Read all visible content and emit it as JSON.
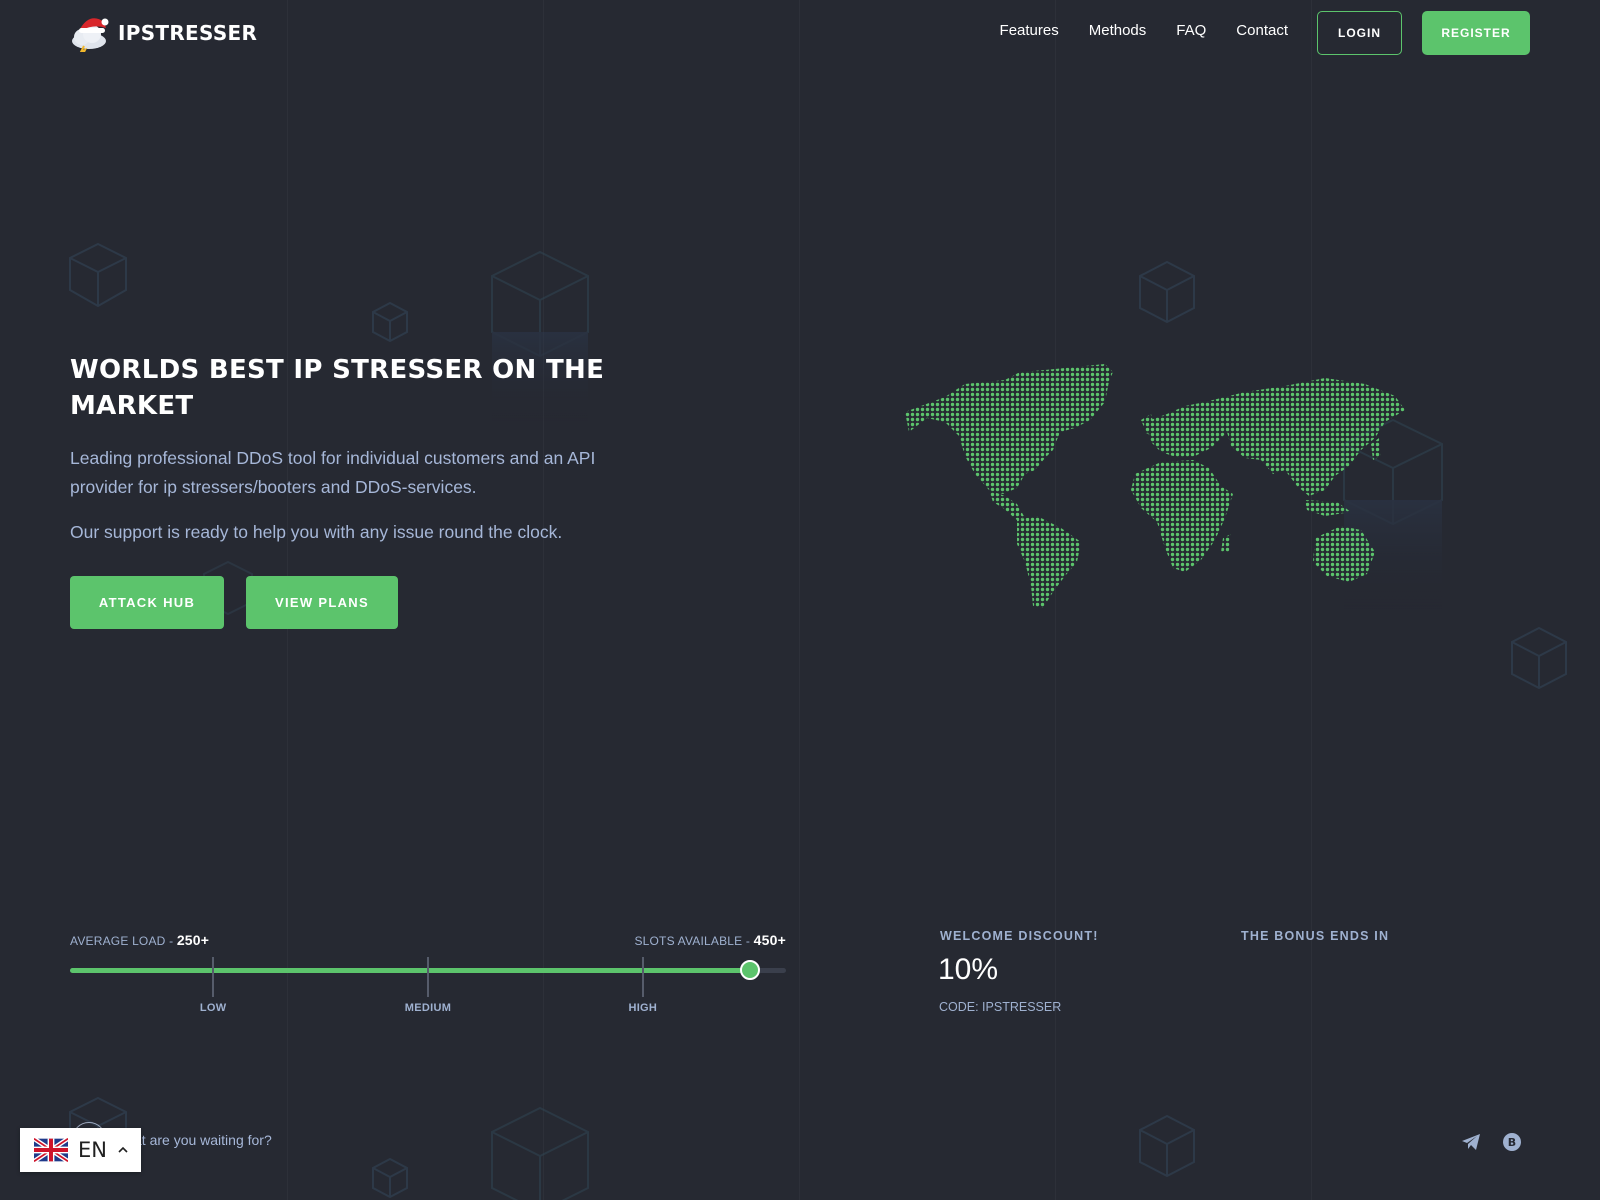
{
  "brand": {
    "name": "IPSTRESSER"
  },
  "nav": {
    "items": [
      "Features",
      "Methods",
      "FAQ",
      "Contact"
    ],
    "login_label": "LOGIN",
    "register_label": "REGISTER"
  },
  "hero": {
    "title": "WORLDS BEST IP STRESSER ON THE MARKET",
    "description": "Leading professional DDoS tool for individual customers and an API provider for ip stressers/booters and DDoS-services.",
    "support": "Our support is ready to help you with any issue round the clock.",
    "attack_hub_label": "ATTACK HUB",
    "view_plans_label": "VIEW PLANS"
  },
  "load": {
    "average_label": "AVERAGE LOAD - ",
    "average_value": "250+",
    "slots_label": "SLOTS AVAILABLE - ",
    "slots_value": "450+",
    "level": 0.95,
    "ticks": [
      {
        "label": "LOW",
        "position": 0.2
      },
      {
        "label": "MEDIUM",
        "position": 0.5
      },
      {
        "label": "HIGH",
        "position": 0.8
      }
    ]
  },
  "promo": {
    "welcome_heading": "WELCOME DISCOUNT!",
    "discount_value": "10%",
    "code_text": "CODE: IPSTRESSER",
    "bonus_heading": "THE BONUS ENDS IN"
  },
  "footer": {
    "waiting_text": "at are you waiting for?",
    "icons": [
      "telegram-icon",
      "bitcoin-icon"
    ]
  },
  "language": {
    "code": "EN",
    "flag": "uk-flag-icon"
  },
  "colors": {
    "background": "#262932",
    "accent": "#5cc46c",
    "text_muted": "#9fb1d0",
    "white": "#ffffff"
  }
}
